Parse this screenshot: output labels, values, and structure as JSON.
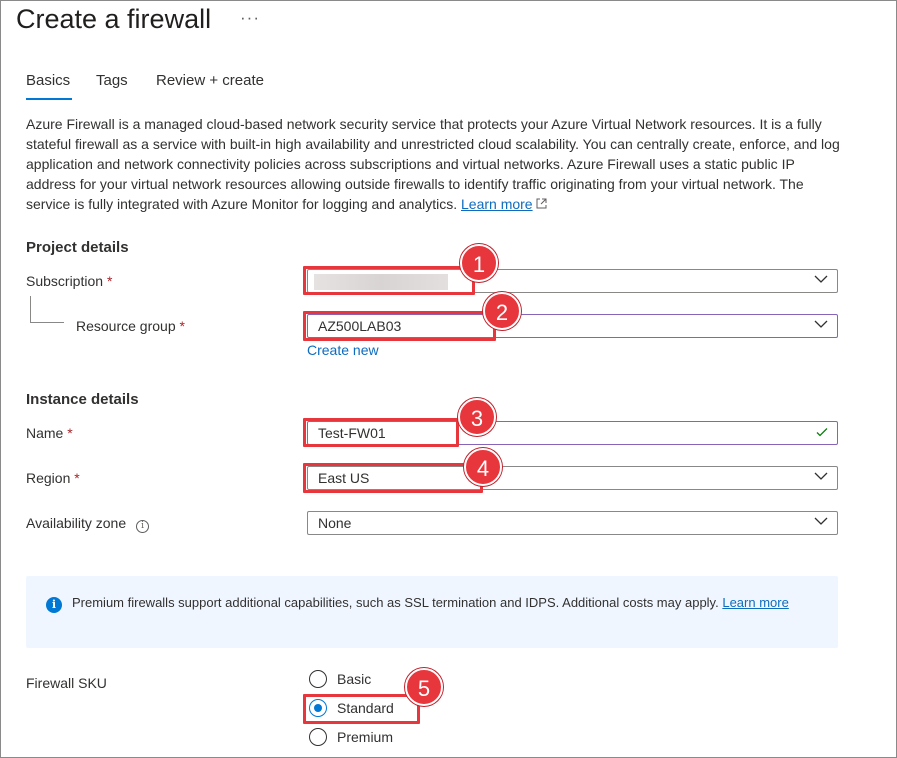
{
  "header": {
    "title": "Create a firewall",
    "more_label": "···"
  },
  "tabs": [
    {
      "label": "Basics",
      "active": true
    },
    {
      "label": "Tags",
      "active": false
    },
    {
      "label": "Review + create",
      "active": false
    }
  ],
  "description": {
    "text": "Azure Firewall is a managed cloud-based network security service that protects your Azure Virtual Network resources. It is a fully stateful firewall as a service with built-in high availability and unrestricted cloud scalability. You can centrally create, enforce, and log application and network connectivity policies across subscriptions and virtual networks. Azure Firewall uses a static public IP address for your virtual network resources allowing outside firewalls to identify traffic originating from your virtual network. The service is fully integrated with Azure Monitor for logging and analytics.",
    "link_label": "Learn more"
  },
  "project_details": {
    "heading": "Project details",
    "subscription_label": "Subscription",
    "subscription_value": "",
    "resource_group_label": "Resource group",
    "resource_group_value": "AZ500LAB03",
    "create_new_label": "Create new"
  },
  "instance_details": {
    "heading": "Instance details",
    "name_label": "Name",
    "name_value": "Test-FW01",
    "region_label": "Region",
    "region_value": "East US",
    "availability_zone_label": "Availability zone",
    "availability_zone_value": "None"
  },
  "info_banner": {
    "text": "Premium firewalls support additional capabilities, such as SSL termination and IDPS. Additional costs may apply.",
    "link_label": "Learn more"
  },
  "sku": {
    "label": "Firewall SKU",
    "options": [
      {
        "label": "Basic",
        "selected": false
      },
      {
        "label": "Standard",
        "selected": true
      },
      {
        "label": "Premium",
        "selected": false
      }
    ]
  },
  "required_marker": "*",
  "annotations": [
    "1",
    "2",
    "3",
    "4",
    "5"
  ],
  "colors": {
    "accent": "#0078d4",
    "link": "#0f6cbd",
    "required": "#a4262c",
    "highlight": "#e8363d",
    "info_background": "#f0f6ff",
    "valid_check": "#107c10"
  }
}
